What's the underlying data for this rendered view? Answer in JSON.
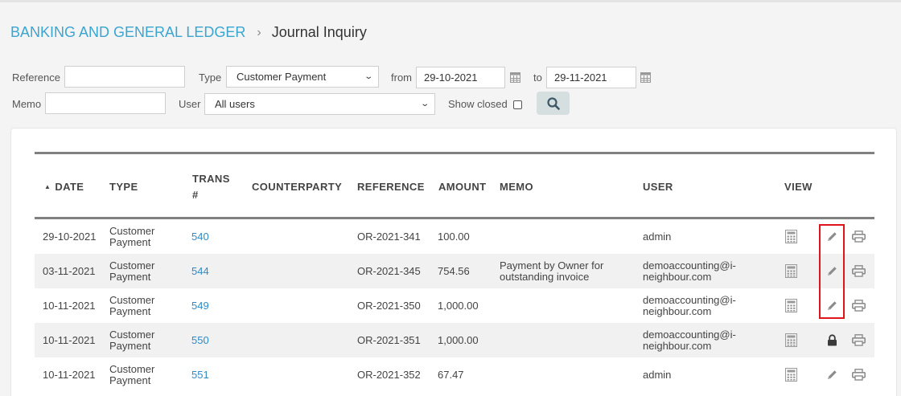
{
  "breadcrumb": {
    "parent": "BANKING AND GENERAL LEDGER",
    "separator": "›",
    "current": "Journal Inquiry"
  },
  "filters": {
    "reference_label": "Reference",
    "reference_value": "",
    "type_label": "Type",
    "type_value": "Customer Payment",
    "from_label": "from",
    "from_value": "29-10-2021",
    "to_label": "to",
    "to_value": "29-11-2021",
    "memo_label": "Memo",
    "memo_value": "",
    "user_label": "User",
    "user_value": "All users",
    "show_closed_label": "Show closed",
    "show_closed_checked": false
  },
  "table": {
    "headers": {
      "date": "DATE",
      "type": "TYPE",
      "trans_line1": "TRANS",
      "trans_line2": "#",
      "counterparty": "COUNTERPARTY",
      "reference": "REFERENCE",
      "amount": "AMOUNT",
      "memo": "MEMO",
      "user": "USER",
      "view": "VIEW"
    },
    "sort": {
      "column": "date",
      "direction": "asc",
      "indicator": "▲"
    },
    "rows": [
      {
        "date": "29-10-2021",
        "type1": "Customer",
        "type2": "Payment",
        "trans": "540",
        "counterparty": "",
        "reference": "OR-2021-341",
        "amount": "100.00",
        "memo1": "",
        "memo2": "",
        "user1": "admin",
        "user2": "",
        "action": "pencil-icon"
      },
      {
        "date": "03-11-2021",
        "type1": "Customer",
        "type2": "Payment",
        "trans": "544",
        "counterparty": "",
        "reference": "OR-2021-345",
        "amount": "754.56",
        "memo1": "Payment by Owner for",
        "memo2": "outstanding invoice",
        "user1": "demoaccounting@i-",
        "user2": "neighbour.com",
        "action": "pencil-icon"
      },
      {
        "date": "10-11-2021",
        "type1": "Customer",
        "type2": "Payment",
        "trans": "549",
        "counterparty": "",
        "reference": "OR-2021-350",
        "amount": "1,000.00",
        "memo1": "",
        "memo2": "",
        "user1": "demoaccounting@i-",
        "user2": "neighbour.com",
        "action": "pencil-icon"
      },
      {
        "date": "10-11-2021",
        "type1": "Customer",
        "type2": "Payment",
        "trans": "550",
        "counterparty": "",
        "reference": "OR-2021-351",
        "amount": "1,000.00",
        "memo1": "",
        "memo2": "",
        "user1": "demoaccounting@i-",
        "user2": "neighbour.com",
        "action": "lock-icon"
      },
      {
        "date": "10-11-2021",
        "type1": "Customer",
        "type2": "Payment",
        "trans": "551",
        "counterparty": "",
        "reference": "OR-2021-352",
        "amount": "67.47",
        "memo1": "",
        "memo2": "",
        "user1": "admin",
        "user2": "",
        "action": "pencil-icon"
      }
    ]
  },
  "colors": {
    "accent": "#3aa6d0",
    "link": "#2e8bc6",
    "highlight": "#e0141b"
  }
}
